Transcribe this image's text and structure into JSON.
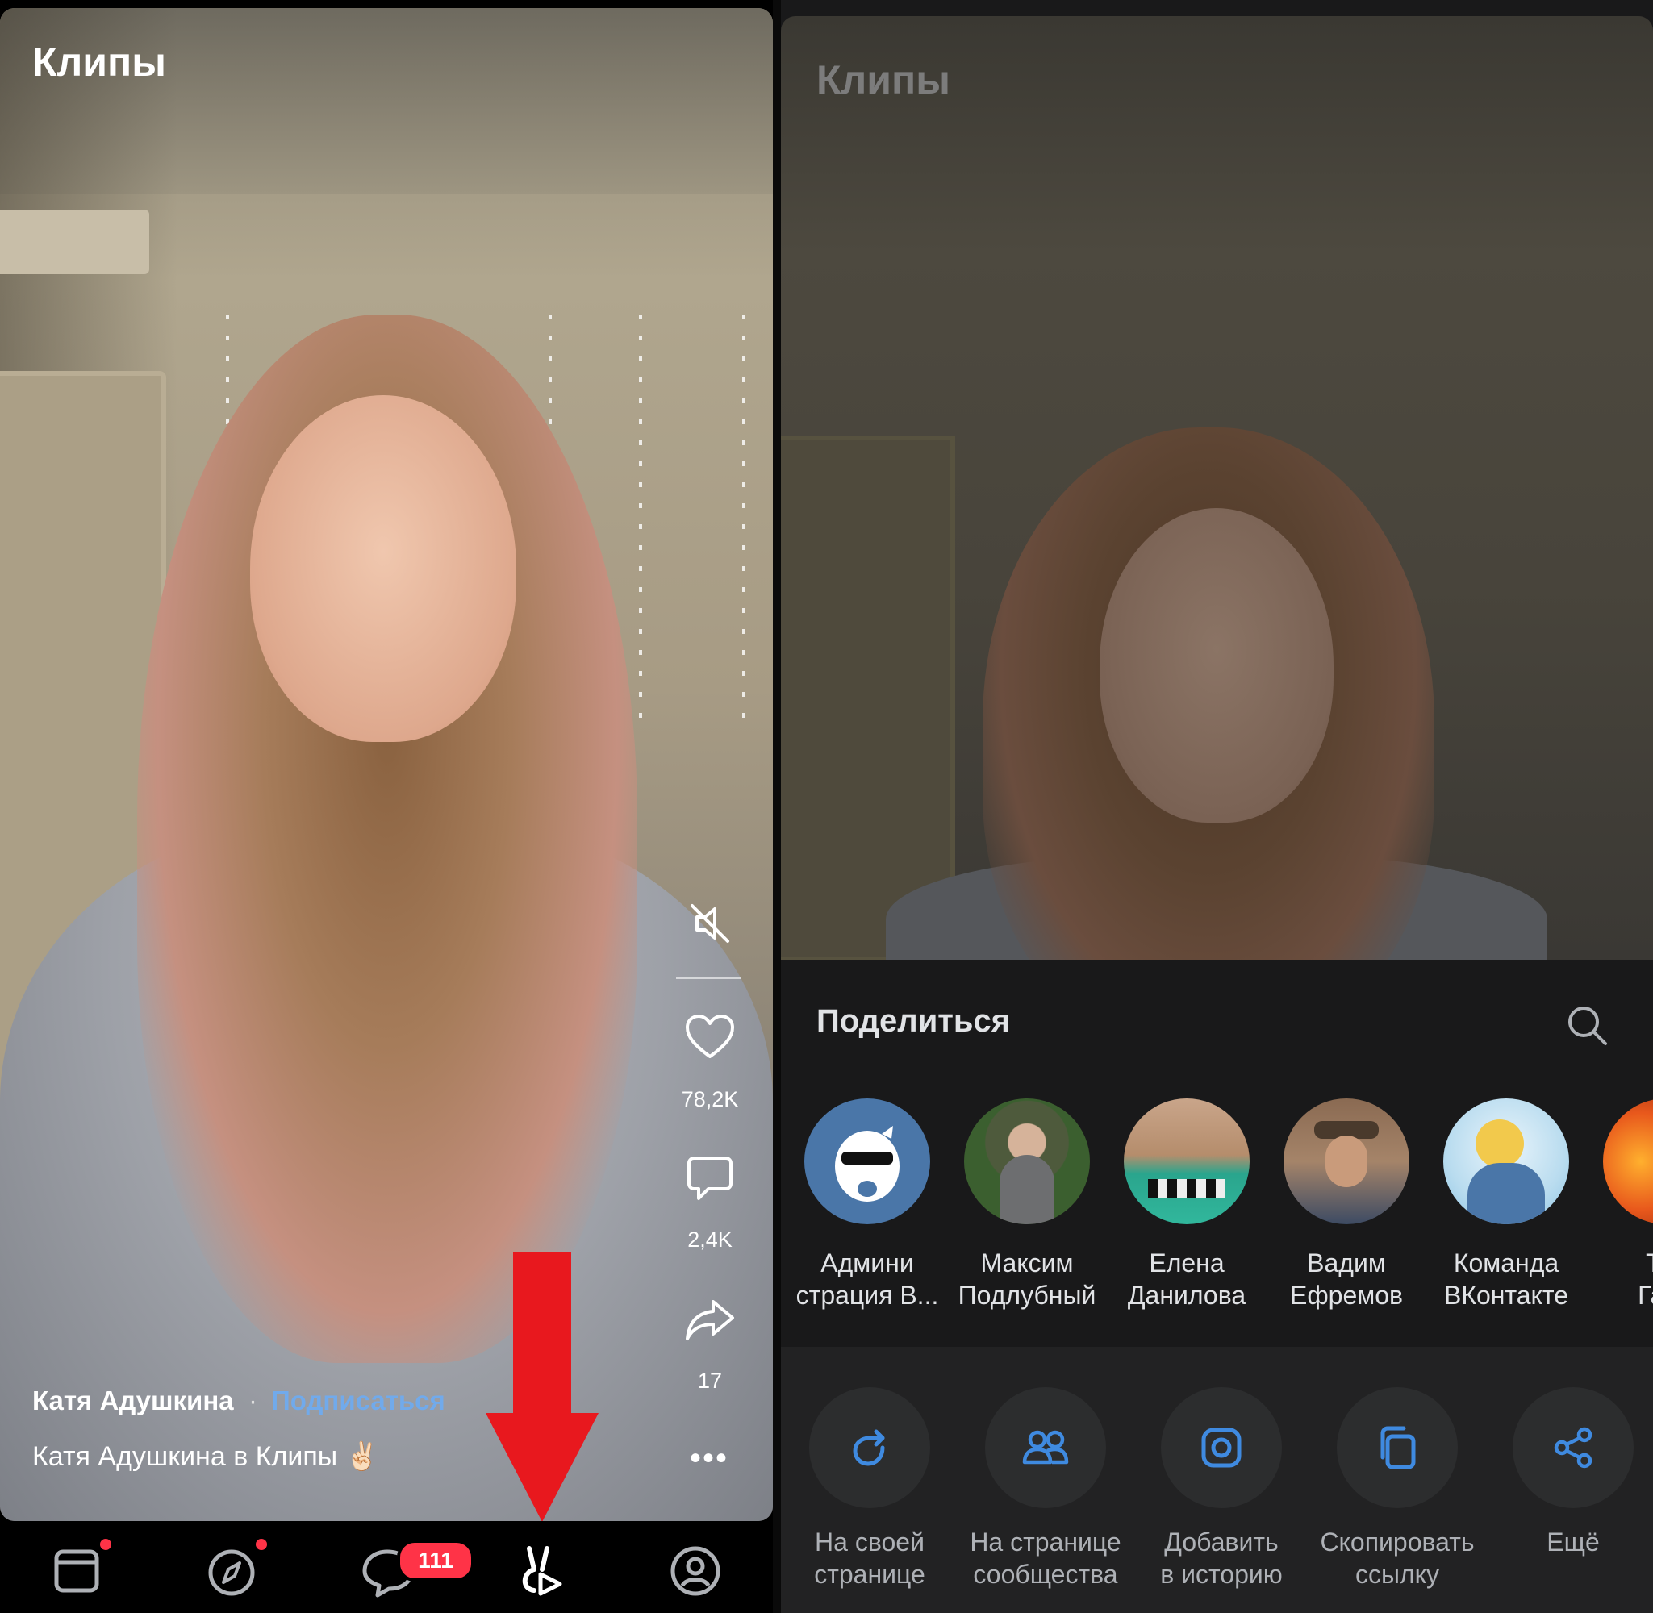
{
  "left": {
    "title": "Клипы",
    "likes": "78,2K",
    "comments": "2,4K",
    "shares": "17",
    "more": "•••",
    "author": "Катя Адушкина",
    "separator": "·",
    "subscribe": "Подписаться",
    "caption": "Катя Адушкина в Клипы ✌🏻",
    "tabbar": {
      "messages_badge": "111",
      "icons": [
        "newsfeed-icon",
        "discover-icon",
        "messages-icon",
        "clips-icon",
        "profile-icon"
      ]
    }
  },
  "right": {
    "title": "Клипы",
    "sheet_title": "Поделиться",
    "contacts": [
      {
        "name": "Админи\nстрация В..."
      },
      {
        "name": "Максим\nПодлубный"
      },
      {
        "name": "Елена\nДанилова"
      },
      {
        "name": "Вадим\nЕфремов"
      },
      {
        "name": "Команда\nВКонтакте"
      },
      {
        "name": "Тат\nГайд"
      }
    ],
    "actions": [
      {
        "label": "На своей\nстранице",
        "icon": "repost-icon"
      },
      {
        "label": "На странице\nсообщества",
        "icon": "community-icon"
      },
      {
        "label": "Добавить\nв историю",
        "icon": "story-icon"
      },
      {
        "label": "Скопировать\nссылку",
        "icon": "copy-link-icon"
      },
      {
        "label": "Ещё",
        "icon": "share-more-icon"
      }
    ]
  },
  "colors": {
    "accent": "#71aaeb",
    "badge": "#ff3347",
    "arrow": "#e8181e",
    "action_icon": "#3f8ae0"
  }
}
